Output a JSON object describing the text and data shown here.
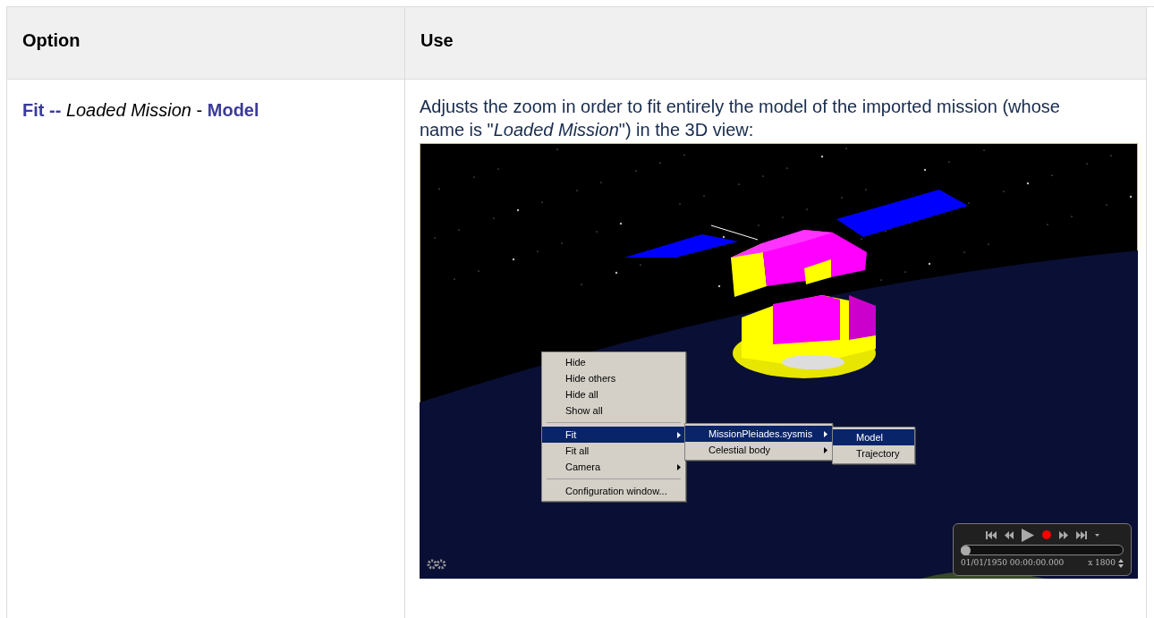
{
  "table": {
    "columns": [
      "Option",
      "Use"
    ],
    "rows": [
      {
        "option": "**Fit --** *Loaded Mission* - **Model**",
        "use": "Adjusts the zoom in order to fit entirely the model of the imported mission (whose name is \"*Loaded Mission*\") in the 3D view:",
        "screenshot": {
          "menus": [
            {
              "items": [
                {
                  "kind": "item",
                  "label": "Hide",
                  "submenu": false,
                  "selected": false
                },
                {
                  "kind": "item",
                  "label": "Hide others",
                  "submenu": false,
                  "selected": false
                },
                {
                  "kind": "item",
                  "label": "Hide all",
                  "submenu": false,
                  "selected": false
                },
                {
                  "kind": "item",
                  "label": "Show all",
                  "submenu": false,
                  "selected": false
                },
                {
                  "kind": "separator"
                },
                {
                  "kind": "item",
                  "label": "Fit",
                  "submenu": true,
                  "selected": true
                },
                {
                  "kind": "item",
                  "label": "Fit all",
                  "submenu": false,
                  "selected": false
                },
                {
                  "kind": "item",
                  "label": "Camera",
                  "submenu": true,
                  "selected": false
                },
                {
                  "kind": "separator"
                },
                {
                  "kind": "item",
                  "label": "Configuration window...",
                  "submenu": false,
                  "selected": false
                }
              ]
            },
            {
              "items": [
                {
                  "kind": "item",
                  "label": "MissionPleiades.sysmis",
                  "submenu": true,
                  "selected": true
                },
                {
                  "kind": "item",
                  "label": "Celestial body",
                  "submenu": true,
                  "selected": false
                }
              ]
            },
            {
              "items": [
                {
                  "kind": "item",
                  "label": "Model",
                  "submenu": false,
                  "selected": true
                },
                {
                  "kind": "item",
                  "label": "Trajectory",
                  "submenu": false,
                  "selected": false
                }
              ]
            }
          ],
          "player": {
            "level": 0,
            "date": "01/01/1950 00:00:00.000",
            "speed": "x 1800",
            "recording": true
          }
        }
      }
    ]
  }
}
